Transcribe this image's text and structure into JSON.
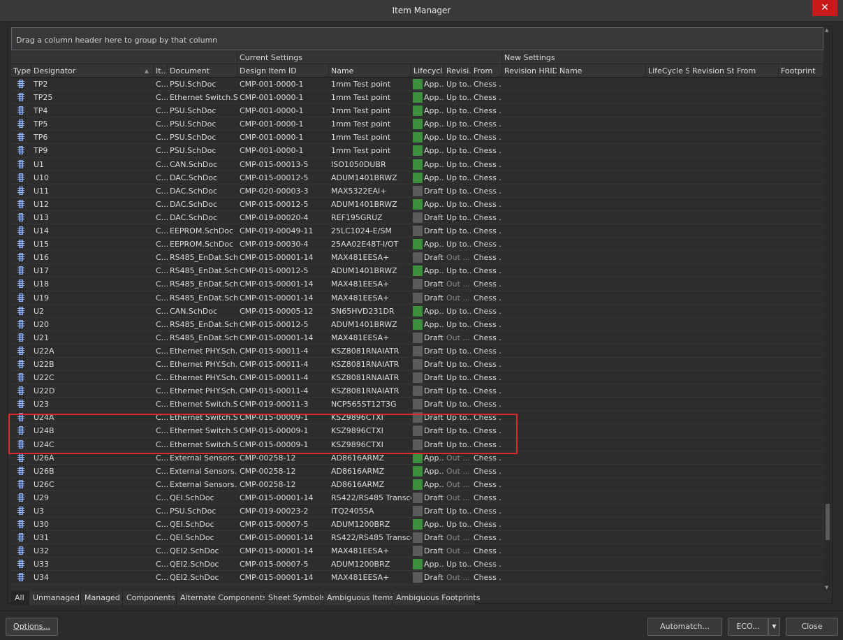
{
  "window": {
    "title": "Item Manager",
    "close_glyph": "✕"
  },
  "group_hint": "Drag a column header here to group by that column",
  "bands": {
    "current": "Current Settings",
    "new": "New Settings"
  },
  "columns": [
    "Type",
    "Designator",
    "It...",
    "Document",
    "Design Item ID",
    "Name",
    "Lifecycl...",
    "Revisi...",
    "From",
    "Revision HRID",
    "Name",
    "LifeCycle S...",
    "Revision St...",
    "From",
    "Footprint"
  ],
  "colors": {
    "approved": "#3d8f3d",
    "draft": "#5b5b5b",
    "highlight": "#e0282e",
    "close": "#c8191b"
  },
  "rows": [
    {
      "des": "TP2",
      "it": "C...",
      "doc": "PSU.SchDoc",
      "id": "CMP-001-0000-1",
      "name": "1mm Test point",
      "lc": "App...",
      "st": "approved",
      "rev": "Up to...",
      "from": "Chess ..."
    },
    {
      "des": "TP25",
      "it": "C...",
      "doc": "Ethernet Switch.Sc...",
      "id": "CMP-001-0000-1",
      "name": "1mm Test point",
      "lc": "App...",
      "st": "approved",
      "rev": "Up to...",
      "from": "Chess ..."
    },
    {
      "des": "TP4",
      "it": "C...",
      "doc": "PSU.SchDoc",
      "id": "CMP-001-0000-1",
      "name": "1mm Test point",
      "lc": "App...",
      "st": "approved",
      "rev": "Up to...",
      "from": "Chess ..."
    },
    {
      "des": "TP5",
      "it": "C...",
      "doc": "PSU.SchDoc",
      "id": "CMP-001-0000-1",
      "name": "1mm Test point",
      "lc": "App...",
      "st": "approved",
      "rev": "Up to...",
      "from": "Chess ..."
    },
    {
      "des": "TP6",
      "it": "C...",
      "doc": "PSU.SchDoc",
      "id": "CMP-001-0000-1",
      "name": "1mm Test point",
      "lc": "App...",
      "st": "approved",
      "rev": "Up to...",
      "from": "Chess ..."
    },
    {
      "des": "TP9",
      "it": "C...",
      "doc": "PSU.SchDoc",
      "id": "CMP-001-0000-1",
      "name": "1mm Test point",
      "lc": "App...",
      "st": "approved",
      "rev": "Up to...",
      "from": "Chess ..."
    },
    {
      "des": "U1",
      "it": "C...",
      "doc": "CAN.SchDoc",
      "id": "CMP-015-00013-5",
      "name": "ISO1050DUBR",
      "lc": "App...",
      "st": "approved",
      "rev": "Up to...",
      "from": "Chess ..."
    },
    {
      "des": "U10",
      "it": "C...",
      "doc": "DAC.SchDoc",
      "id": "CMP-015-00012-5",
      "name": "ADUM1401BRWZ",
      "lc": "App...",
      "st": "approved",
      "rev": "Up to...",
      "from": "Chess ..."
    },
    {
      "des": "U11",
      "it": "C...",
      "doc": "DAC.SchDoc",
      "id": "CMP-020-00003-3",
      "name": "MAX5322EAI+",
      "lc": "Draft",
      "st": "draft",
      "rev": "Up to...",
      "from": "Chess ..."
    },
    {
      "des": "U12",
      "it": "C...",
      "doc": "DAC.SchDoc",
      "id": "CMP-015-00012-5",
      "name": "ADUM1401BRWZ",
      "lc": "App...",
      "st": "approved",
      "rev": "Up to...",
      "from": "Chess ..."
    },
    {
      "des": "U13",
      "it": "C...",
      "doc": "DAC.SchDoc",
      "id": "CMP-019-00020-4",
      "name": "REF195GRUZ",
      "lc": "Draft",
      "st": "draft",
      "rev": "Up to...",
      "from": "Chess ..."
    },
    {
      "des": "U14",
      "it": "C...",
      "doc": "EEPROM.SchDoc",
      "id": "CMP-019-00049-11",
      "name": "25LC1024-E/SM",
      "lc": "Draft",
      "st": "draft",
      "rev": "Up to...",
      "from": "Chess ..."
    },
    {
      "des": "U15",
      "it": "C...",
      "doc": "EEPROM.SchDoc",
      "id": "CMP-019-00030-4",
      "name": "25AA02E48T-I/OT",
      "lc": "App...",
      "st": "approved",
      "rev": "Up to...",
      "from": "Chess ..."
    },
    {
      "des": "U16",
      "it": "C...",
      "doc": "RS485_EnDat.Sch...",
      "id": "CMP-015-00001-14",
      "name": "MAX481EESA+",
      "lc": "Draft",
      "st": "draft",
      "rev": "Out ...",
      "from": "Chess ..."
    },
    {
      "des": "U17",
      "it": "C...",
      "doc": "RS485_EnDat.Sch...",
      "id": "CMP-015-00012-5",
      "name": "ADUM1401BRWZ",
      "lc": "App...",
      "st": "approved",
      "rev": "Up to...",
      "from": "Chess ..."
    },
    {
      "des": "U18",
      "it": "C...",
      "doc": "RS485_EnDat.Sch...",
      "id": "CMP-015-00001-14",
      "name": "MAX481EESA+",
      "lc": "Draft",
      "st": "draft",
      "rev": "Out ...",
      "from": "Chess ..."
    },
    {
      "des": "U19",
      "it": "C...",
      "doc": "RS485_EnDat.Sch...",
      "id": "CMP-015-00001-14",
      "name": "MAX481EESA+",
      "lc": "Draft",
      "st": "draft",
      "rev": "Out ...",
      "from": "Chess ..."
    },
    {
      "des": "U2",
      "it": "C...",
      "doc": "CAN.SchDoc",
      "id": "CMP-015-00005-12",
      "name": "SN65HVD231DR",
      "lc": "App...",
      "st": "approved",
      "rev": "Up to...",
      "from": "Chess ..."
    },
    {
      "des": "U20",
      "it": "C...",
      "doc": "RS485_EnDat.Sch...",
      "id": "CMP-015-00012-5",
      "name": "ADUM1401BRWZ",
      "lc": "App...",
      "st": "approved",
      "rev": "Up to...",
      "from": "Chess ..."
    },
    {
      "des": "U21",
      "it": "C...",
      "doc": "RS485_EnDat.Sch...",
      "id": "CMP-015-00001-14",
      "name": "MAX481EESA+",
      "lc": "Draft",
      "st": "draft",
      "rev": "Out ...",
      "from": "Chess ..."
    },
    {
      "des": "U22A",
      "it": "C...",
      "doc": "Ethernet PHY.Sch...",
      "id": "CMP-015-00011-4",
      "name": "KSZ8081RNAIATR",
      "lc": "Draft",
      "st": "draft",
      "rev": "Up to...",
      "from": "Chess ..."
    },
    {
      "des": "U22B",
      "it": "C...",
      "doc": "Ethernet PHY.Sch...",
      "id": "CMP-015-00011-4",
      "name": "KSZ8081RNAIATR",
      "lc": "Draft",
      "st": "draft",
      "rev": "Up to...",
      "from": "Chess ..."
    },
    {
      "des": "U22C",
      "it": "C...",
      "doc": "Ethernet PHY.Sch...",
      "id": "CMP-015-00011-4",
      "name": "KSZ8081RNAIATR",
      "lc": "Draft",
      "st": "draft",
      "rev": "Up to...",
      "from": "Chess ..."
    },
    {
      "des": "U22D",
      "it": "C...",
      "doc": "Ethernet PHY.Sch...",
      "id": "CMP-015-00011-4",
      "name": "KSZ8081RNAIATR",
      "lc": "Draft",
      "st": "draft",
      "rev": "Up to...",
      "from": "Chess ..."
    },
    {
      "des": "U23",
      "it": "C...",
      "doc": "Ethernet Switch.Sc...",
      "id": "CMP-019-00011-3",
      "name": "NCP565ST12T3G",
      "lc": "Draft",
      "st": "draft",
      "rev": "Up to...",
      "from": "Chess ..."
    },
    {
      "des": "U24A",
      "it": "C...",
      "doc": "Ethernet Switch.Sc...",
      "id": "CMP-015-00009-1",
      "name": "KSZ9896CTXI",
      "lc": "Draft",
      "st": "draft",
      "rev": "Up to...",
      "from": "Chess ..."
    },
    {
      "des": "U24B",
      "it": "C...",
      "doc": "Ethernet Switch.Sc...",
      "id": "CMP-015-00009-1",
      "name": "KSZ9896CTXI",
      "lc": "Draft",
      "st": "draft",
      "rev": "Up to...",
      "from": "Chess ..."
    },
    {
      "des": "U24C",
      "it": "C...",
      "doc": "Ethernet Switch.Sc...",
      "id": "CMP-015-00009-1",
      "name": "KSZ9896CTXI",
      "lc": "Draft",
      "st": "draft",
      "rev": "Up to...",
      "from": "Chess ..."
    },
    {
      "des": "U26A",
      "it": "C...",
      "doc": "External Sensors.S...",
      "id": "CMP-00258-12",
      "name": "AD8616ARMZ",
      "lc": "App...",
      "st": "approved",
      "rev": "Out ...",
      "from": "Chess ..."
    },
    {
      "des": "U26B",
      "it": "C...",
      "doc": "External Sensors.S...",
      "id": "CMP-00258-12",
      "name": "AD8616ARMZ",
      "lc": "App...",
      "st": "approved",
      "rev": "Out ...",
      "from": "Chess ..."
    },
    {
      "des": "U26C",
      "it": "C...",
      "doc": "External Sensors.S...",
      "id": "CMP-00258-12",
      "name": "AD8616ARMZ",
      "lc": "App...",
      "st": "approved",
      "rev": "Out ...",
      "from": "Chess ..."
    },
    {
      "des": "U29",
      "it": "C...",
      "doc": "QEI.SchDoc",
      "id": "CMP-015-00001-14",
      "name": "RS422/RS485 Transce...",
      "lc": "Draft",
      "st": "draft",
      "rev": "Out ...",
      "from": "Chess ..."
    },
    {
      "des": "U3",
      "it": "C...",
      "doc": "PSU.SchDoc",
      "id": "CMP-019-00023-2",
      "name": "ITQ2405SA",
      "lc": "Draft",
      "st": "draft",
      "rev": "Up to...",
      "from": "Chess ..."
    },
    {
      "des": "U30",
      "it": "C...",
      "doc": "QEI.SchDoc",
      "id": "CMP-015-00007-5",
      "name": "ADUM1200BRZ",
      "lc": "App...",
      "st": "approved",
      "rev": "Up to...",
      "from": "Chess ..."
    },
    {
      "des": "U31",
      "it": "C...",
      "doc": "QEI.SchDoc",
      "id": "CMP-015-00001-14",
      "name": "RS422/RS485 Transce...",
      "lc": "Draft",
      "st": "draft",
      "rev": "Out ...",
      "from": "Chess ..."
    },
    {
      "des": "U32",
      "it": "C...",
      "doc": "QEI2.SchDoc",
      "id": "CMP-015-00001-14",
      "name": "MAX481EESA+",
      "lc": "Draft",
      "st": "draft",
      "rev": "Out ...",
      "from": "Chess ..."
    },
    {
      "des": "U33",
      "it": "C...",
      "doc": "QEI2.SchDoc",
      "id": "CMP-015-00007-5",
      "name": "ADUM1200BRZ",
      "lc": "App...",
      "st": "approved",
      "rev": "Up to...",
      "from": "Chess ..."
    },
    {
      "des": "U34",
      "it": "C...",
      "doc": "QEI2.SchDoc",
      "id": "CMP-015-00001-14",
      "name": "MAX481EESA+",
      "lc": "Draft",
      "st": "draft",
      "rev": "Out ...",
      "from": "Chess ..."
    }
  ],
  "tabs": [
    "All",
    "Unmanaged",
    "Managed",
    "Components",
    "Alternate Components",
    "Sheet Symbols",
    "Ambiguous Items",
    "Ambiguous Footprints"
  ],
  "active_tab": "All",
  "buttons": {
    "options": "Options...",
    "automatch": "Automatch...",
    "eco": "ECO...",
    "close": "Close"
  }
}
